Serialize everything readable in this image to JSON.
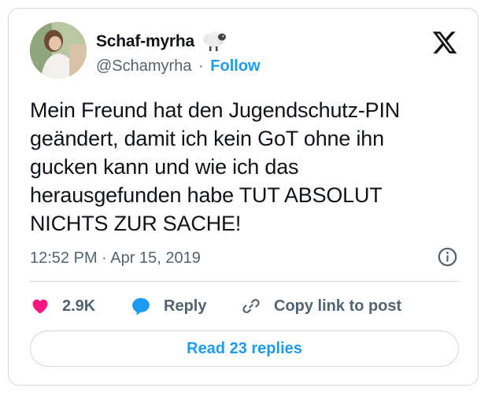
{
  "author": {
    "display_name": "Schaf-myrha",
    "handle": "@Schamyrha",
    "separator": "·",
    "follow_label": "Follow",
    "avatar_icon": "profile-photo",
    "badge_icon": "sheep-emoji"
  },
  "platform_icon": "x-logo-icon",
  "tweet": {
    "text": "Mein Freund hat den Jugendschutz-PIN\ngeändert, damit ich kein GoT ohne ihn\ngucken kann und wie ich das\nherausgefunden habe TUT ABSOLUT\nNICHTS ZUR SACHE!",
    "time": "12:52 PM",
    "separator": "·",
    "date": "Apr 15, 2019"
  },
  "actions": {
    "like_count": "2.9K",
    "reply_label": "Reply",
    "copy_label": "Copy link to post"
  },
  "read_replies_label": "Read 23 replies",
  "colors": {
    "accent": "#1d9bf0",
    "like": "#f91880",
    "muted": "#536471",
    "border": "#cfd9de"
  }
}
